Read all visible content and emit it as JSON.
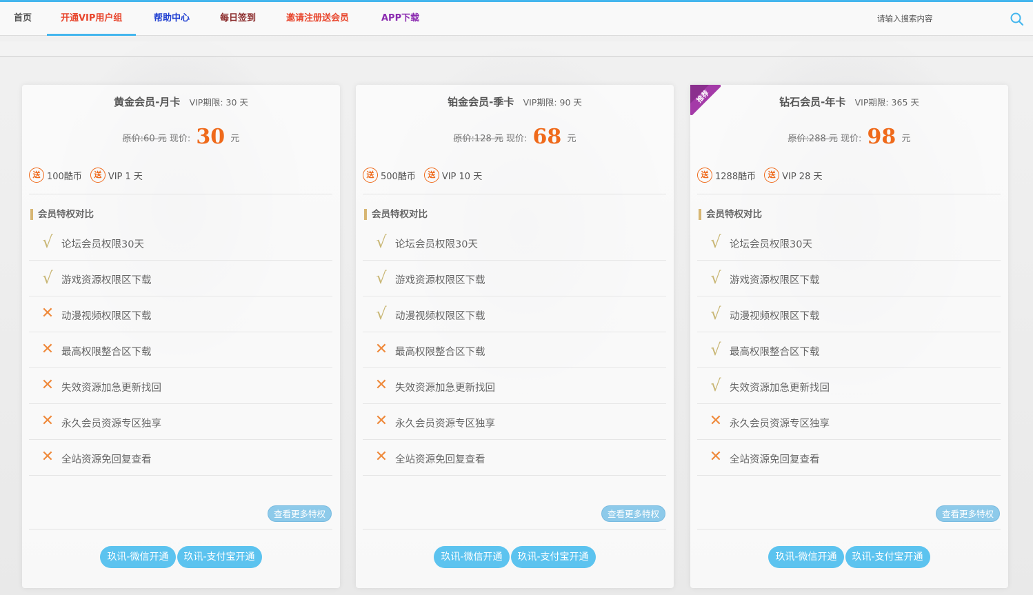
{
  "nav": {
    "items": [
      {
        "label": "首页",
        "color": "#555555"
      },
      {
        "label": "开通VIP用户组",
        "color": "#e8452c"
      },
      {
        "label": "帮助中心",
        "color": "#1f3fd1"
      },
      {
        "label": "每日签到",
        "color": "#8a2a2a"
      },
      {
        "label": "邀请注册送会员",
        "color": "#e8452c"
      },
      {
        "label": "APP下载",
        "color": "#8b2bb0"
      }
    ],
    "active_index": 1,
    "search_placeholder": "请输入搜索内容",
    "search_icon": "search-icon",
    "accent": "#44b6ee"
  },
  "plans": [
    {
      "title": "黄金会员-月卡",
      "period_label": "VIP期限: 30 天",
      "orig_price": "原价:60 元",
      "now_label": "现价:",
      "price": "30",
      "unit": "元",
      "gift_badge": "送",
      "gifts": [
        "100酷币",
        "VIP 1 天"
      ],
      "section_title": "会员特权对比",
      "features": [
        {
          "text": "论坛会员权限30天",
          "ok": true,
          "mark": "√"
        },
        {
          "text": "游戏资源权限区下载",
          "ok": true,
          "mark": "√"
        },
        {
          "text": "动漫视频权限区下载",
          "ok": false,
          "mark": "✕"
        },
        {
          "text": "最高权限整合区下载",
          "ok": false,
          "mark": "✕"
        },
        {
          "text": "失效资源加急更新找回",
          "ok": false,
          "mark": "✕"
        },
        {
          "text": "永久会员资源专区独享",
          "ok": false,
          "mark": "✕"
        },
        {
          "text": "全站资源免回复查看",
          "ok": false,
          "mark": "✕"
        }
      ],
      "more_label": "查看更多特权",
      "pay_wechat": "玖讯-微信开通",
      "pay_alipay": "玖讯-支付宝开通"
    },
    {
      "title": "铂金会员-季卡",
      "period_label": "VIP期限: 90 天",
      "orig_price": "原价:128 元",
      "now_label": "现价:",
      "price": "68",
      "unit": "元",
      "gift_badge": "送",
      "gifts": [
        "500酷币",
        "VIP 10 天"
      ],
      "section_title": "会员特权对比",
      "features": [
        {
          "text": "论坛会员权限30天",
          "ok": true,
          "mark": "√"
        },
        {
          "text": "游戏资源权限区下载",
          "ok": true,
          "mark": "√"
        },
        {
          "text": "动漫视频权限区下载",
          "ok": true,
          "mark": "√"
        },
        {
          "text": "最高权限整合区下载",
          "ok": false,
          "mark": "✕"
        },
        {
          "text": "失效资源加急更新找回",
          "ok": false,
          "mark": "✕"
        },
        {
          "text": "永久会员资源专区独享",
          "ok": false,
          "mark": "✕"
        },
        {
          "text": "全站资源免回复查看",
          "ok": false,
          "mark": "✕"
        }
      ],
      "more_label": "查看更多特权",
      "pay_wechat": "玖讯-微信开通",
      "pay_alipay": "玖讯-支付宝开通"
    },
    {
      "title": "钻石会员-年卡",
      "period_label": "VIP期限: 365 天",
      "orig_price": "原价:288 元",
      "now_label": "现价:",
      "price": "98",
      "unit": "元",
      "gift_badge": "送",
      "gifts": [
        "1288酷币",
        "VIP 28 天"
      ],
      "section_title": "会员特权对比",
      "ribbon": "推荐",
      "features": [
        {
          "text": "论坛会员权限30天",
          "ok": true,
          "mark": "√"
        },
        {
          "text": "游戏资源权限区下载",
          "ok": true,
          "mark": "√"
        },
        {
          "text": "动漫视频权限区下载",
          "ok": true,
          "mark": "√"
        },
        {
          "text": "最高权限整合区下载",
          "ok": true,
          "mark": "√"
        },
        {
          "text": "失效资源加急更新找回",
          "ok": true,
          "mark": "√"
        },
        {
          "text": "永久会员资源专区独享",
          "ok": false,
          "mark": "✕"
        },
        {
          "text": "全站资源免回复查看",
          "ok": false,
          "mark": "✕"
        }
      ],
      "more_label": "查看更多特权",
      "pay_wechat": "玖讯-微信开通",
      "pay_alipay": "玖讯-支付宝开通"
    }
  ]
}
